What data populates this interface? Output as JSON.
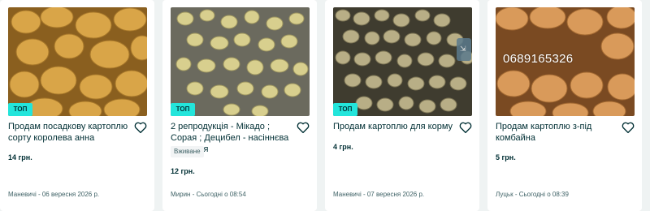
{
  "listings": [
    {
      "title": "Продам посадкову картоплю сорту королева анна",
      "price": "14 грн.",
      "location_date": "Маневичі - 06 вересня 2026 р.",
      "badge": "ТОП",
      "condition": "",
      "image_desc": "yellow potatoes close-up"
    },
    {
      "title": "2 репродукція - Мікадо ; Сорая ; Децибел - насіннєва картопля",
      "price": "12 грн.",
      "location_date": "Мирин - Сьогодні о 08:54",
      "badge": "ТОП",
      "condition": "Вживане",
      "image_desc": "small potatoes on ground"
    },
    {
      "title": "Продам картоплю для корму",
      "price": "4 грн.",
      "location_date": "Маневичі - 07 вересня 2026 р.",
      "badge": "ТОП",
      "condition": "",
      "image_desc": "many small potatoes"
    },
    {
      "title": "Продам картоплю з-під комбайна",
      "price": "5 грн.",
      "location_date": "Луцьк - Сьогодні о 08:39",
      "badge": "",
      "condition": "",
      "phone_overlay": "0689165326",
      "image_desc": "potatoes with phone number"
    }
  ],
  "colors": {
    "accent": "#23e5db",
    "text": "#002f34",
    "muted": "#406367",
    "background": "#eff3f3"
  },
  "icons": {
    "favorite": "heart-outline-icon"
  }
}
